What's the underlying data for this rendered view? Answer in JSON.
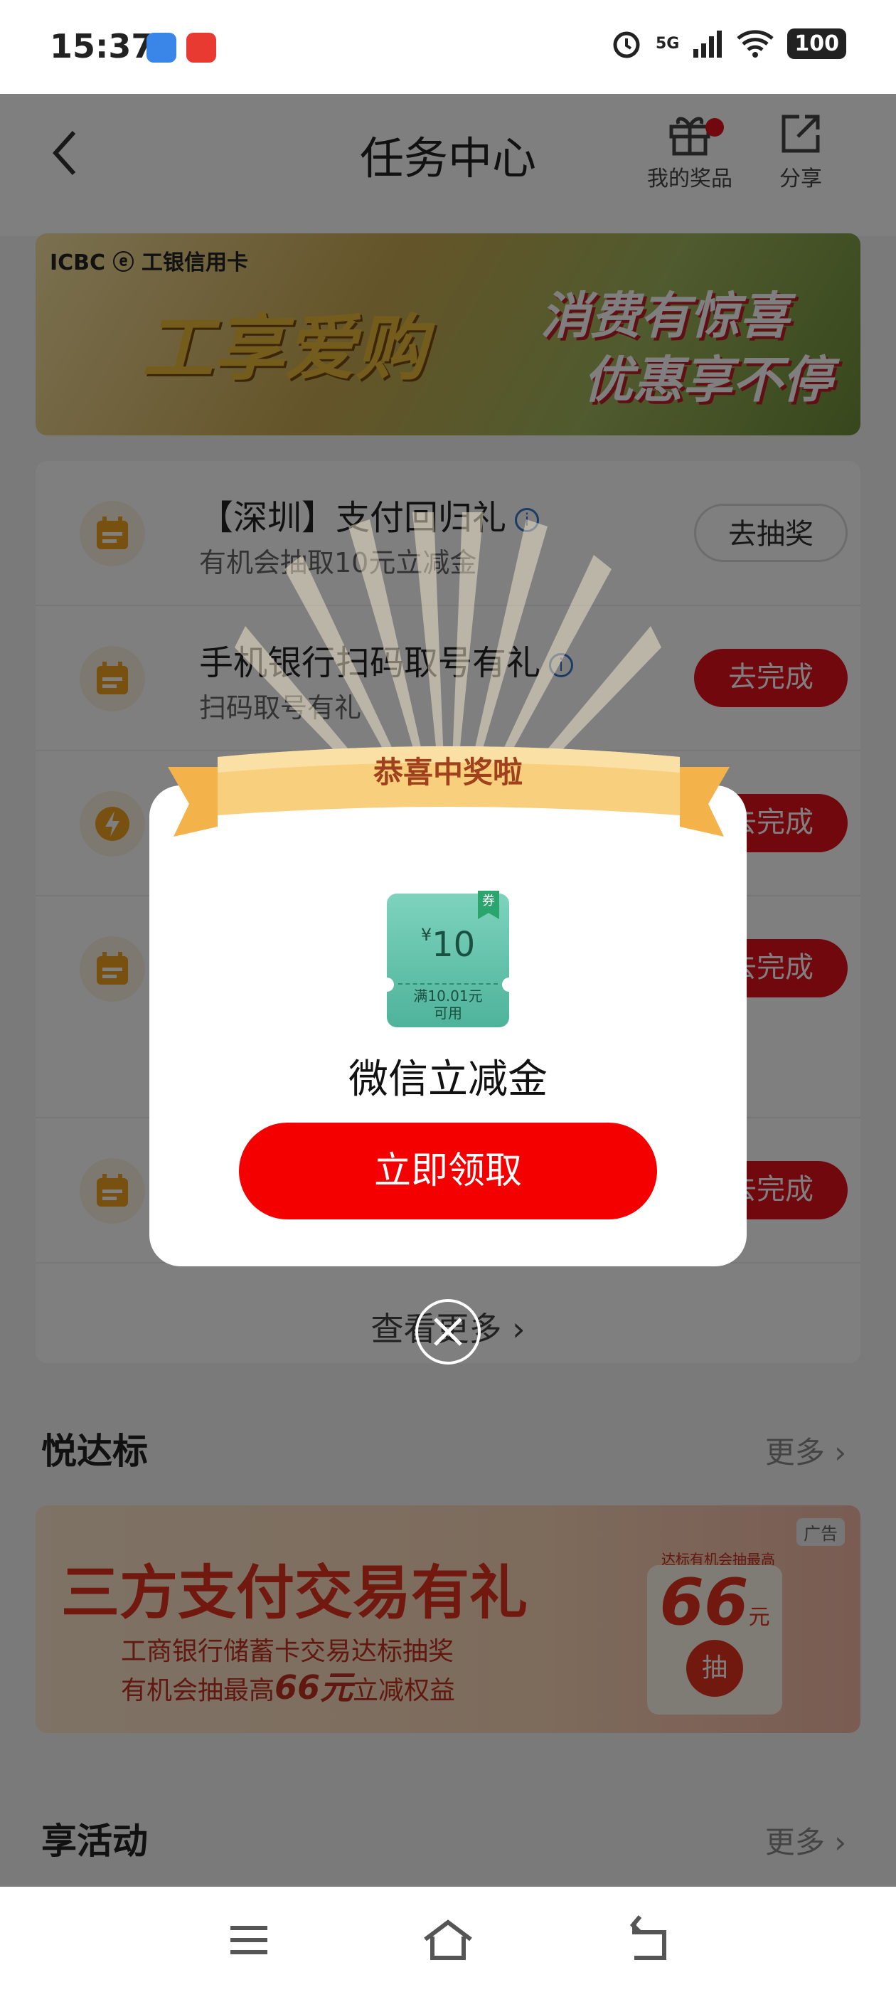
{
  "status_bar": {
    "time": "15:37",
    "network": "5G",
    "battery": "100"
  },
  "header": {
    "title": "任务中心",
    "my_prizes_label": "我的奖品",
    "share_label": "分享"
  },
  "banner": {
    "logo_text": "ICBC ⓔ 工银信用卡",
    "big_text": "工享爱购",
    "slogan_line1": "消费有惊喜",
    "slogan_line2": "优惠享不停"
  },
  "tasks": [
    {
      "title": "【深圳】支付回归礼",
      "subtitle": "有机会抽取10元立减金",
      "button": "去抽奖",
      "icon": "calendar-icon"
    },
    {
      "title": "手机银行扫码取号有礼",
      "subtitle": "扫码取号有礼",
      "button": "去完成",
      "icon": "calendar-icon"
    },
    {
      "title": "",
      "subtitle": "",
      "button": "去完成",
      "icon": "lightning-icon"
    },
    {
      "title": "",
      "subtitle": "",
      "button": "去完成",
      "icon": "calendar-icon"
    },
    {
      "title": "",
      "subtitle": "",
      "button": "去完成",
      "icon": "calendar-icon"
    }
  ],
  "view_more": "查看更多 ›",
  "sections": {
    "yuedabiao": "悦达标",
    "xianghuodong": "享活动",
    "more": "更多 ›"
  },
  "ad": {
    "tag": "广告",
    "title": "三方支付交易有礼",
    "line1": "工商银行储蓄卡交易达标抽奖",
    "line2_prefix": "有机会抽最高",
    "line2_amount": "66元",
    "line2_suffix": "立减权益",
    "card_small": "达标有机会抽最高",
    "card_amount": "66",
    "card_unit": "元",
    "card_draw": "抽"
  },
  "modal": {
    "ribbon": "恭喜中奖啦",
    "coupon_currency": "¥",
    "coupon_value": "10",
    "coupon_badge": "券",
    "coupon_condition_1": "满10.01元",
    "coupon_condition_2": "可用",
    "prize_name": "微信立减金",
    "claim_button": "立即领取"
  }
}
